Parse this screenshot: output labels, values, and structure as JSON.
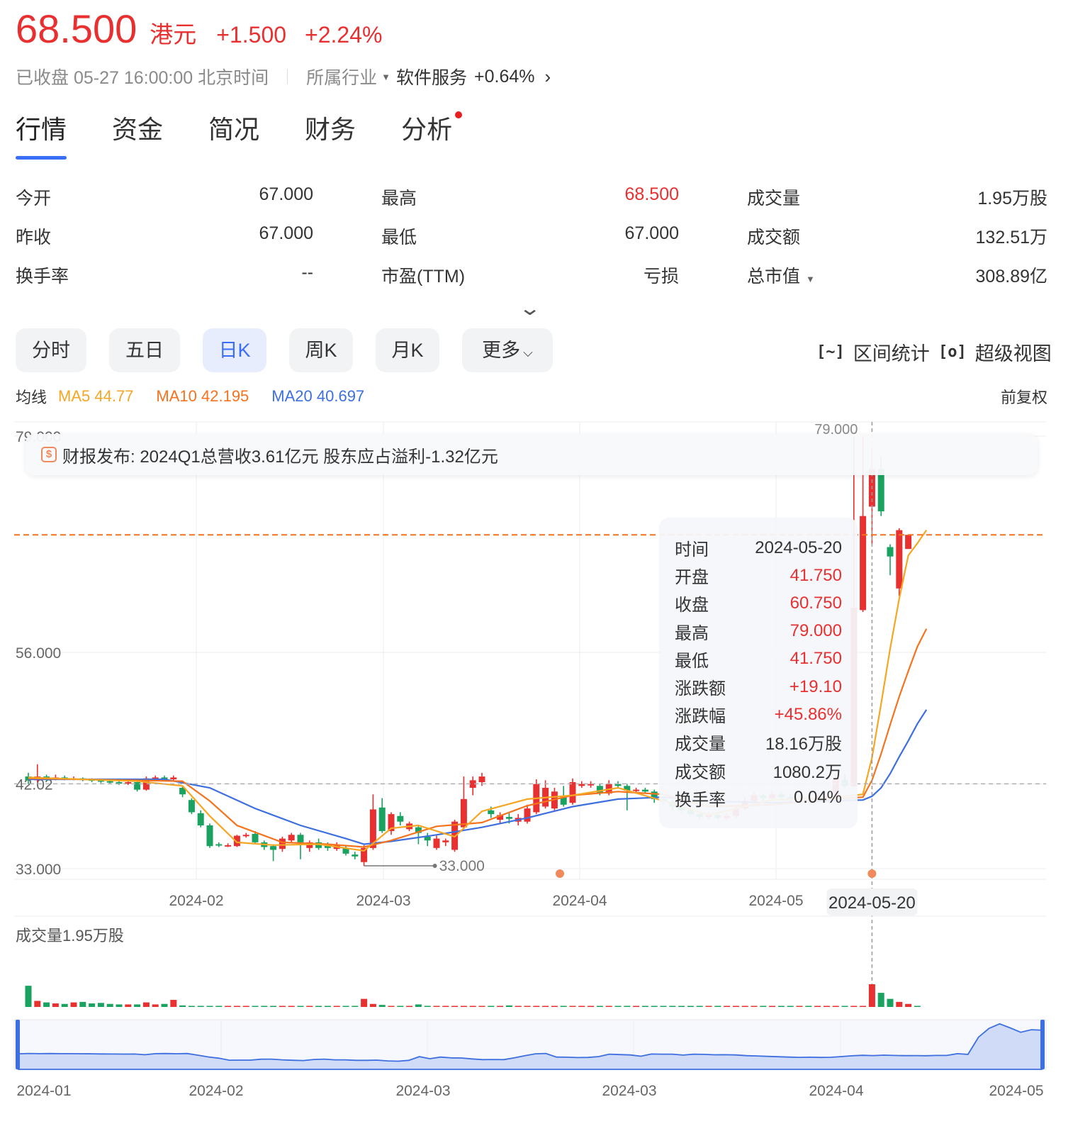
{
  "quote": {
    "price": "68.500",
    "currency": "港元",
    "change": "+1.500",
    "change_pct": "+2.24%",
    "status": "已收盘 05-27 16:00:00 北京时间",
    "industry_label": "所属行业",
    "industry_name": "软件服务",
    "industry_change": "+0.64%",
    "color_up": "#e93030",
    "color_down": "#1aa260"
  },
  "tabs": [
    "行情",
    "资金",
    "简况",
    "财务",
    "分析"
  ],
  "stats": [
    [
      {
        "k": "今开",
        "v": "67.000"
      },
      {
        "k": "最高",
        "v": "68.500"
      },
      {
        "k": "成交量",
        "v": "1.95万股"
      }
    ],
    [
      {
        "k": "昨收",
        "v": "67.000"
      },
      {
        "k": "最低",
        "v": "67.000"
      },
      {
        "k": "成交额",
        "v": "132.51万"
      }
    ],
    [
      {
        "k": "换手率",
        "v": "--"
      },
      {
        "k": "市盈(TTM)",
        "v": "亏损"
      },
      {
        "k": "总市值",
        "v": "308.89亿"
      }
    ]
  ],
  "periods": [
    "分时",
    "五日",
    "日K",
    "周K",
    "月K",
    "更多"
  ],
  "tools": {
    "range_stats": "区间统计",
    "super_view": "超级视图"
  },
  "ma": {
    "label": "均线",
    "ma5": "MA5 44.77",
    "ma10": "MA10 42.195",
    "ma20": "MA20 40.697",
    "adjust": "前复权"
  },
  "report": "财报发布: 2024Q1总营收3.61亿元 股东应占溢利-1.32亿元",
  "tooltip": [
    {
      "k": "时间",
      "v": "2024-05-20"
    },
    {
      "k": "开盘",
      "v": "41.750"
    },
    {
      "k": "收盘",
      "v": "60.750"
    },
    {
      "k": "最高",
      "v": "79.000"
    },
    {
      "k": "最低",
      "v": "41.750"
    },
    {
      "k": "涨跌额",
      "v": "+19.10"
    },
    {
      "k": "涨跌幅",
      "v": "+45.86%"
    },
    {
      "k": "成交量",
      "v": "18.16万股"
    },
    {
      "k": "成交额",
      "v": "1080.2万"
    },
    {
      "k": "换手率",
      "v": "0.04%"
    }
  ],
  "volume_label": "成交量1.95万股",
  "chart_data": {
    "type": "candlestick",
    "y_labels": [
      "79.000",
      "56.000",
      "42.02",
      "33.000"
    ],
    "ylim": [
      33.0,
      79.0
    ],
    "x_labels": [
      "2024-02",
      "2024-03",
      "2024-04",
      "2024-05"
    ],
    "crosshair_label": "2024-05-20",
    "top_marker": "79.000",
    "low_marker": "33.000",
    "ref_line": 42.02,
    "current_price_line": 68.5,
    "candles": [
      {
        "o": 42.8,
        "c": 42.4,
        "h": 43.2,
        "l": 42.0
      },
      {
        "o": 42.4,
        "c": 42.8,
        "h": 44.1,
        "l": 42.2
      },
      {
        "o": 42.8,
        "c": 42.6,
        "h": 43.0,
        "l": 42.3
      },
      {
        "o": 42.6,
        "c": 42.7,
        "h": 43.0,
        "l": 42.4
      },
      {
        "o": 42.7,
        "c": 42.6,
        "h": 42.9,
        "l": 42.4
      },
      {
        "o": 42.6,
        "c": 42.6,
        "h": 42.8,
        "l": 42.4
      },
      {
        "o": 42.6,
        "c": 42.5,
        "h": 42.7,
        "l": 42.3
      },
      {
        "o": 42.5,
        "c": 42.4,
        "h": 42.6,
        "l": 42.2
      },
      {
        "o": 42.4,
        "c": 42.3,
        "h": 42.5,
        "l": 42.1
      },
      {
        "o": 42.3,
        "c": 42.2,
        "h": 42.4,
        "l": 42.0
      },
      {
        "o": 42.2,
        "c": 42.1,
        "h": 42.3,
        "l": 41.9
      },
      {
        "o": 42.1,
        "c": 42.2,
        "h": 42.4,
        "l": 41.9
      },
      {
        "o": 42.2,
        "c": 41.4,
        "h": 42.4,
        "l": 41.2
      },
      {
        "o": 41.4,
        "c": 42.6,
        "h": 42.8,
        "l": 41.3
      },
      {
        "o": 42.6,
        "c": 42.7,
        "h": 42.9,
        "l": 42.3
      },
      {
        "o": 42.7,
        "c": 42.5,
        "h": 42.9,
        "l": 42.3
      },
      {
        "o": 42.5,
        "c": 42.7,
        "h": 42.9,
        "l": 42.3
      },
      {
        "o": 41.6,
        "c": 40.9,
        "h": 41.8,
        "l": 40.6
      },
      {
        "o": 40.3,
        "c": 39.0,
        "h": 40.5,
        "l": 38.8
      },
      {
        "o": 38.9,
        "c": 37.6,
        "h": 39.2,
        "l": 37.4
      },
      {
        "o": 37.6,
        "c": 35.4,
        "h": 37.8,
        "l": 35.2
      },
      {
        "o": 35.6,
        "c": 35.5,
        "h": 35.8,
        "l": 35.3
      },
      {
        "o": 35.5,
        "c": 35.5,
        "h": 35.7,
        "l": 35.3
      },
      {
        "o": 35.4,
        "c": 36.5,
        "h": 36.6,
        "l": 35.3
      },
      {
        "o": 36.5,
        "c": 36.6,
        "h": 36.8,
        "l": 36.3
      },
      {
        "o": 36.7,
        "c": 35.8,
        "h": 37.0,
        "l": 35.6
      },
      {
        "o": 35.8,
        "c": 35.3,
        "h": 36.0,
        "l": 35.0
      },
      {
        "o": 35.4,
        "c": 35.0,
        "h": 35.6,
        "l": 33.8
      },
      {
        "o": 35.1,
        "c": 36.2,
        "h": 36.4,
        "l": 34.8
      },
      {
        "o": 36.0,
        "c": 36.6,
        "h": 36.8,
        "l": 35.8
      },
      {
        "o": 36.6,
        "c": 35.8,
        "h": 36.8,
        "l": 34.0
      },
      {
        "o": 35.2,
        "c": 35.8,
        "h": 36.0,
        "l": 34.8
      },
      {
        "o": 35.8,
        "c": 35.2,
        "h": 36.2,
        "l": 35.0
      },
      {
        "o": 35.6,
        "c": 35.2,
        "h": 35.8,
        "l": 34.9
      },
      {
        "o": 35.1,
        "c": 35.5,
        "h": 35.8,
        "l": 34.9
      },
      {
        "o": 35.2,
        "c": 34.6,
        "h": 35.4,
        "l": 34.4
      },
      {
        "o": 34.5,
        "c": 34.3,
        "h": 34.8,
        "l": 34.0
      },
      {
        "o": 33.7,
        "c": 35.2,
        "h": 35.5,
        "l": 33.3
      },
      {
        "o": 35.2,
        "c": 39.3,
        "h": 40.9,
        "l": 35.0
      },
      {
        "o": 39.5,
        "c": 37.0,
        "h": 40.5,
        "l": 36.8
      },
      {
        "o": 37.0,
        "c": 38.8,
        "h": 39.0,
        "l": 36.6
      },
      {
        "o": 38.6,
        "c": 38.0,
        "h": 39.0,
        "l": 37.6
      },
      {
        "o": 37.2,
        "c": 37.8,
        "h": 38.0,
        "l": 37.0
      },
      {
        "o": 37.4,
        "c": 36.8,
        "h": 37.6,
        "l": 35.6
      },
      {
        "o": 36.4,
        "c": 36.0,
        "h": 36.8,
        "l": 35.4
      },
      {
        "o": 35.2,
        "c": 36.2,
        "h": 36.5,
        "l": 35.0
      },
      {
        "o": 35.8,
        "c": 36.0,
        "h": 36.2,
        "l": 35.4
      },
      {
        "o": 35.0,
        "c": 38.0,
        "h": 38.2,
        "l": 34.8
      },
      {
        "o": 37.4,
        "c": 40.4,
        "h": 42.8,
        "l": 37.2
      },
      {
        "o": 41.6,
        "c": 42.4,
        "h": 42.8,
        "l": 40.8
      },
      {
        "o": 42.2,
        "c": 42.8,
        "h": 43.2,
        "l": 41.8
      },
      {
        "o": 39.2,
        "c": 38.8,
        "h": 39.6,
        "l": 38.4
      },
      {
        "o": 38.2,
        "c": 38.7,
        "h": 39.0,
        "l": 37.8
      },
      {
        "o": 38.5,
        "c": 38.3,
        "h": 38.9,
        "l": 37.8
      },
      {
        "o": 38.0,
        "c": 38.4,
        "h": 38.8,
        "l": 37.6
      },
      {
        "o": 38.0,
        "c": 39.4,
        "h": 39.8,
        "l": 37.8
      },
      {
        "o": 39.0,
        "c": 42.0,
        "h": 42.5,
        "l": 38.8
      },
      {
        "o": 39.6,
        "c": 41.6,
        "h": 42.4,
        "l": 39.4
      },
      {
        "o": 39.4,
        "c": 41.2,
        "h": 41.6,
        "l": 39.2
      },
      {
        "o": 40.6,
        "c": 39.8,
        "h": 41.8,
        "l": 39.6
      },
      {
        "o": 40.0,
        "c": 42.2,
        "h": 42.6,
        "l": 39.8
      },
      {
        "o": 41.8,
        "c": 42.0,
        "h": 42.3,
        "l": 41.6
      },
      {
        "o": 42.0,
        "c": 42.0,
        "h": 42.3,
        "l": 41.6
      },
      {
        "o": 41.8,
        "c": 41.0,
        "h": 42.0,
        "l": 40.8
      },
      {
        "o": 41.0,
        "c": 42.0,
        "h": 42.4,
        "l": 40.8
      },
      {
        "o": 42.0,
        "c": 41.8,
        "h": 42.3,
        "l": 41.5
      },
      {
        "o": 41.8,
        "c": 41.3,
        "h": 42.0,
        "l": 39.2
      },
      {
        "o": 41.3,
        "c": 41.4,
        "h": 41.6,
        "l": 41.0
      },
      {
        "o": 41.4,
        "c": 41.2,
        "h": 41.6,
        "l": 41.0
      },
      {
        "o": 41.2,
        "c": 40.4,
        "h": 41.4,
        "l": 40.0
      },
      {
        "o": 40.4,
        "c": 40.1,
        "h": 40.6,
        "l": 39.8
      },
      {
        "o": 40.1,
        "c": 39.6,
        "h": 40.3,
        "l": 39.2
      },
      {
        "o": 39.6,
        "c": 39.2,
        "h": 39.8,
        "l": 38.9
      },
      {
        "o": 39.2,
        "c": 38.8,
        "h": 39.4,
        "l": 38.6
      },
      {
        "o": 38.8,
        "c": 38.5,
        "h": 39.0,
        "l": 38.2
      },
      {
        "o": 38.5,
        "c": 38.7,
        "h": 39.0,
        "l": 38.3
      },
      {
        "o": 38.7,
        "c": 38.4,
        "h": 38.9,
        "l": 38.2
      },
      {
        "o": 38.4,
        "c": 38.6,
        "h": 38.9,
        "l": 38.2
      },
      {
        "o": 38.6,
        "c": 39.4,
        "h": 39.8,
        "l": 38.4
      },
      {
        "o": 39.4,
        "c": 40.2,
        "h": 40.6,
        "l": 39.2
      },
      {
        "o": 40.2,
        "c": 40.8,
        "h": 41.2,
        "l": 40.0
      },
      {
        "o": 40.8,
        "c": 40.5,
        "h": 41.0,
        "l": 40.2
      },
      {
        "o": 40.5,
        "c": 40.9,
        "h": 41.2,
        "l": 40.2
      },
      {
        "o": 40.9,
        "c": 40.6,
        "h": 41.2,
        "l": 40.4
      },
      {
        "o": 40.6,
        "c": 40.4,
        "h": 40.9,
        "l": 40.1
      },
      {
        "o": 40.4,
        "c": 40.5,
        "h": 40.8,
        "l": 40.2
      },
      {
        "o": 40.5,
        "c": 40.3,
        "h": 40.8,
        "l": 40.1
      },
      {
        "o": 40.4,
        "c": 40.6,
        "h": 40.8,
        "l": 40.2
      },
      {
        "o": 40.3,
        "c": 40.6,
        "h": 40.9,
        "l": 40.1
      },
      {
        "o": 40.6,
        "c": 42.6,
        "h": 43.0,
        "l": 40.4
      },
      {
        "o": 42.4,
        "c": 41.8,
        "h": 43.0,
        "l": 41.6
      },
      {
        "o": 41.75,
        "c": 60.75,
        "h": 79.0,
        "l": 41.75
      },
      {
        "o": 60.5,
        "c": 70.5,
        "h": 79.0,
        "l": 60.3
      },
      {
        "o": 71.5,
        "c": 75.5,
        "h": 77.5,
        "l": 67.5
      },
      {
        "o": 75.5,
        "c": 71.0,
        "h": 76.8,
        "l": 70.5
      },
      {
        "o": 67.2,
        "c": 66.2,
        "h": 67.5,
        "l": 64.2
      },
      {
        "o": 62.8,
        "c": 69.0,
        "h": 69.2,
        "l": 62.0
      },
      {
        "o": 67.0,
        "c": 68.5,
        "h": 68.5,
        "l": 67.0
      }
    ],
    "volumes": [
      4.2,
      1.2,
      0.9,
      0.7,
      0.6,
      0.9,
      1.0,
      0.7,
      0.8,
      0.6,
      0.5,
      0.5,
      0.5,
      0.9,
      0.5,
      0.6,
      1.4,
      0.3,
      0.2,
      0.2,
      0.2,
      0.2,
      0.2,
      0.2,
      0.2,
      0.2,
      0.2,
      0.2,
      0.2,
      0.2,
      0.2,
      0.2,
      0.2,
      0.2,
      0.2,
      0.2,
      0.2,
      1.6,
      0.6,
      0.4,
      0.2,
      0.2,
      0.2,
      0.5,
      0.2,
      0.2,
      0.2,
      0.2,
      0.2,
      0.2,
      0.2,
      0.2,
      0.2,
      0.3,
      0.2,
      0.2,
      0.2,
      0.2,
      0.2,
      0.2,
      0.2,
      0.2,
      0.2,
      0.2,
      0.2,
      0.2,
      0.2,
      0.2,
      0.2,
      0.2,
      0.2,
      0.2,
      0.2,
      0.2,
      0.2,
      0.2,
      0.2,
      0.2,
      0.2,
      0.2,
      0.2,
      0.2,
      0.2,
      0.2,
      0.2,
      0.2,
      0.2,
      0.2,
      0.2,
      0.2,
      0.2,
      0.2,
      0.2,
      4.5,
      2.8,
      1.6,
      1.0,
      0.6,
      0.2
    ],
    "ma5": [
      [
        0,
        42.7
      ],
      [
        12,
        42.3
      ],
      [
        17,
        41.8
      ],
      [
        20,
        38.6
      ],
      [
        23,
        35.8
      ],
      [
        27,
        35.5
      ],
      [
        32,
        35.6
      ],
      [
        37,
        34.9
      ],
      [
        40,
        37.3
      ],
      [
        43,
        37.6
      ],
      [
        47,
        36.4
      ],
      [
        50,
        39.1
      ],
      [
        55,
        40.4
      ],
      [
        60,
        40.8
      ],
      [
        65,
        41.6
      ],
      [
        70,
        40.2
      ],
      [
        75,
        38.7
      ],
      [
        82,
        40.3
      ],
      [
        88,
        40.5
      ],
      [
        92,
        40.9
      ],
      [
        93,
        44.8
      ],
      [
        94,
        50.5
      ],
      [
        95,
        56.4
      ],
      [
        96,
        61.7
      ],
      [
        97,
        66.3
      ],
      [
        98,
        67.6
      ],
      [
        99,
        69.0
      ]
    ],
    "ma10": [
      [
        0,
        42.6
      ],
      [
        17,
        42.3
      ],
      [
        20,
        40.2
      ],
      [
        23,
        37.6
      ],
      [
        28,
        35.8
      ],
      [
        33,
        35.6
      ],
      [
        37,
        35.3
      ],
      [
        40,
        36.0
      ],
      [
        45,
        37.5
      ],
      [
        50,
        37.9
      ],
      [
        55,
        39.7
      ],
      [
        60,
        40.8
      ],
      [
        65,
        41.2
      ],
      [
        70,
        40.9
      ],
      [
        75,
        39.6
      ],
      [
        82,
        39.8
      ],
      [
        88,
        40.4
      ],
      [
        92,
        40.6
      ],
      [
        93,
        42.4
      ],
      [
        94,
        45.2
      ],
      [
        95,
        48.3
      ],
      [
        96,
        51.3
      ],
      [
        97,
        54.0
      ],
      [
        98,
        56.6
      ],
      [
        99,
        58.5
      ]
    ],
    "ma20": [
      [
        0,
        42.5
      ],
      [
        15,
        42.5
      ],
      [
        20,
        41.6
      ],
      [
        25,
        39.4
      ],
      [
        30,
        37.6
      ],
      [
        35,
        36.2
      ],
      [
        37,
        35.6
      ],
      [
        40,
        35.9
      ],
      [
        45,
        36.6
      ],
      [
        50,
        37.4
      ],
      [
        55,
        38.4
      ],
      [
        60,
        39.6
      ],
      [
        65,
        40.4
      ],
      [
        70,
        40.6
      ],
      [
        75,
        40.2
      ],
      [
        82,
        40.0
      ],
      [
        88,
        40.2
      ],
      [
        92,
        40.3
      ],
      [
        93,
        40.7
      ],
      [
        94,
        41.6
      ],
      [
        95,
        43.1
      ],
      [
        96,
        44.9
      ],
      [
        97,
        46.6
      ],
      [
        98,
        48.4
      ],
      [
        99,
        49.9
      ]
    ],
    "navigator": {
      "x_labels": [
        "2024-01",
        "2024-02",
        "2024-03",
        "2024-03",
        "2024-04",
        "2024-05"
      ]
    }
  }
}
